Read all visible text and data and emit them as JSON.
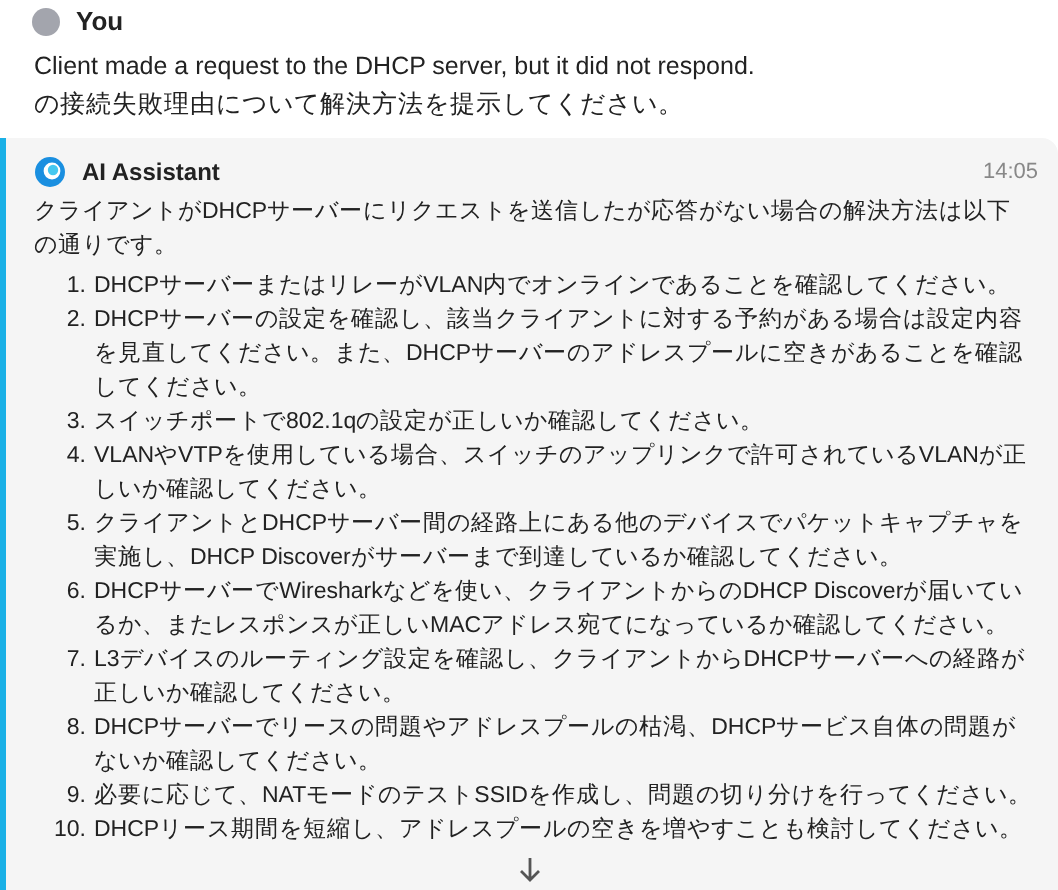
{
  "user": {
    "name": "You",
    "lines": [
      "Client made a request to the DHCP server, but it did not respond.",
      "の接続失敗理由について解決方法を提示してください。"
    ]
  },
  "assistant": {
    "name": "AI Assistant",
    "time": "14:05",
    "intro": "クライアントがDHCPサーバーにリクエストを送信したが応答がない場合の解決方法は以下の通りです。",
    "steps": [
      {
        "number": "1.",
        "text": "DHCPサーバーまたはリレーがVLAN内でオンラインであることを確認してください。"
      },
      {
        "number": "2.",
        "text": "DHCPサーバーの設定を確認し、該当クライアントに対する予約がある場合は設定内容を見直してください。また、DHCPサーバーのアドレスプールに空きがあることを確認してください。"
      },
      {
        "number": "3.",
        "text": "スイッチポートで802.1qの設定が正しいか確認してください。"
      },
      {
        "number": "4.",
        "text": "VLANやVTPを使用している場合、スイッチのアップリンクで許可されているVLANが正しいか確認してください。"
      },
      {
        "number": "5.",
        "text": "クライアントとDHCPサーバー間の経路上にある他のデバイスでパケットキャプチャを実施し、DHCP Discoverがサーバーまで到達しているか確認してください。"
      },
      {
        "number": "6.",
        "text": "DHCPサーバーでWiresharkなどを使い、クライアントからのDHCP Discoverが届いているか、またレスポンスが正しいMACアドレス宛てになっているか確認してください。"
      },
      {
        "number": "7.",
        "text": "L3デバイスのルーティング設定を確認し、クライアントからDHCPサーバーへの経路が正しいか確認してください。"
      },
      {
        "number": "8.",
        "text": "DHCPサーバーでリースの問題やアドレスプールの枯渇、DHCPサービス自体の問題がないか確認してください。"
      },
      {
        "number": "9.",
        "text": "必要に応じて、NATモードのテストSSIDを作成し、問題の切り分けを行ってください。"
      },
      {
        "number": "10.",
        "text": "DHCPリース期間を短縮し、アドレスプールの空きを増やすことも検討してください。"
      }
    ]
  }
}
